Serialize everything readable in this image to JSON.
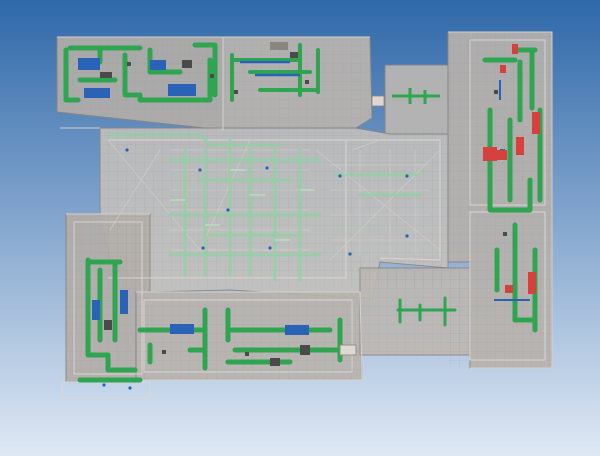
{
  "viewport": {
    "background_top": "#2f68a9",
    "background_bottom": "#dfe8f4"
  },
  "palette": {
    "shell_fill": "#b3aea9",
    "shell_fill_light": "#c7c2bc",
    "wall_edge": "#8a8580",
    "wall_light": "#ddd8d2",
    "grid_line": "#9c9792",
    "duct_green": "#2fa552",
    "duct_green_light": "#8ed3a0",
    "duct_green_faint": "#b7dcc0",
    "equip_blue": "#2a62b8",
    "equip_red": "#d8403e",
    "equip_dark": "#4a4a4a"
  }
}
